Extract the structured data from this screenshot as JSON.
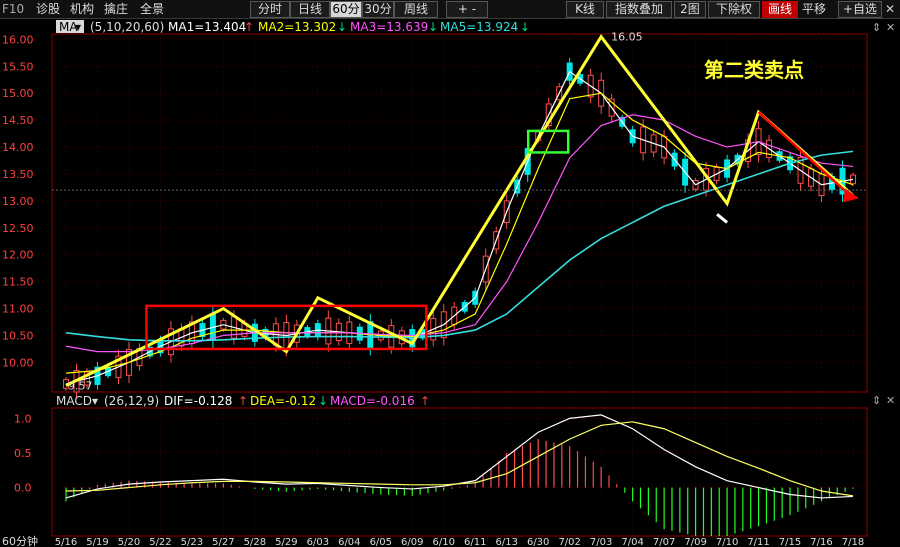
{
  "toolbar": {
    "f10": "F10",
    "left_tabs": [
      "诊股",
      "机构",
      "擒庄",
      "全景"
    ],
    "period_tabs": [
      "分时",
      "日线",
      "60分",
      "30分",
      "周线"
    ],
    "active_period": "60分",
    "plus_minus": "+ -",
    "right_buttons": [
      "K线",
      "指数叠加",
      "2图",
      "下除权",
      "画线",
      "平移",
      "+自选"
    ],
    "close_glyph": "✕"
  },
  "ma_legend": {
    "label": "MA",
    "params": "(5,10,20,60)",
    "ma1": "MA1=13.404",
    "ma2": "MA2=13.302",
    "ma3": "MA3=13.639",
    "ma5": "MA5=13.924",
    "ma1_arrow": "↑",
    "ma2_arrow": "↓",
    "ma3_arrow": "↓",
    "ma5_arrow": "↓"
  },
  "macd_legend": {
    "label": "MACD",
    "params": "(26,12,9)",
    "dif": "DIF=-0.128",
    "dea": "DEA=-0.12",
    "macd": "MACD=-0.016",
    "dif_arrow": "↑",
    "dea_arrow": "↓",
    "macd_arrow": "↑"
  },
  "annotation_title": "第二类卖点",
  "period_label": "60分钟",
  "colors": {
    "background": "#000000",
    "up": "#ff4d4d",
    "down": "#00e5e5",
    "ma1": "#ffffff",
    "ma2": "#ffff00",
    "ma3": "#ff55ff",
    "ma5": "#33dddd",
    "annotation_yellow": "#ffff33",
    "box_red": "#ff0000",
    "box_green": "#33ff33",
    "axis": "#8b0000"
  },
  "chart_data": [
    {
      "type": "candlestick",
      "title": "",
      "y_ticks": [
        "16.00",
        "15.50",
        "15.00",
        "14.50",
        "14.00",
        "13.50",
        "13.00",
        "12.50",
        "12.00",
        "11.50",
        "11.00",
        "10.50",
        "10.00"
      ],
      "ylim": [
        9.45,
        16.1
      ],
      "x_dates": [
        "5/16",
        "5/19",
        "5/20",
        "5/22",
        "5/23",
        "5/27",
        "5/28",
        "5/29",
        "6/03",
        "6/04",
        "6/05",
        "6/09",
        "6/10",
        "6/11",
        "6/13",
        "6/30",
        "7/02",
        "7/03",
        "7/04",
        "7/07",
        "7/09",
        "7/10",
        "7/11",
        "7/15",
        "7/16",
        "7/18"
      ],
      "price_labels": [
        "9.57",
        "16.05"
      ],
      "price_path": [
        {
          "x": "5/16",
          "y": 9.57
        },
        {
          "x": "5/27",
          "y": 11.0
        },
        {
          "x": "5/29",
          "y": 10.2
        },
        {
          "x": "6/03",
          "y": 11.2
        },
        {
          "x": "6/09",
          "y": 10.35
        },
        {
          "x": "7/03",
          "y": 16.05
        },
        {
          "x": "7/10",
          "y": 12.95
        },
        {
          "x": "7/11",
          "y": 14.65
        },
        {
          "x": "7/18",
          "y": 13.1
        }
      ],
      "series": [
        {
          "name": "MA1",
          "values": [
            9.6,
            9.75,
            10.0,
            10.3,
            10.55,
            10.7,
            10.55,
            10.5,
            10.6,
            10.55,
            10.5,
            10.45,
            10.7,
            11.2,
            12.8,
            14.2,
            15.4,
            15.0,
            14.2,
            14.0,
            13.3,
            13.6,
            14.1,
            13.7,
            13.3,
            13.4
          ]
        },
        {
          "name": "MA2",
          "values": [
            9.8,
            9.85,
            10.0,
            10.2,
            10.45,
            10.6,
            10.6,
            10.55,
            10.55,
            10.55,
            10.5,
            10.48,
            10.6,
            10.9,
            12.2,
            13.6,
            14.9,
            15.0,
            14.5,
            14.2,
            13.7,
            13.6,
            13.9,
            13.8,
            13.5,
            13.3
          ]
        },
        {
          "name": "MA3",
          "values": [
            10.3,
            10.2,
            10.2,
            10.25,
            10.35,
            10.5,
            10.55,
            10.55,
            10.55,
            10.55,
            10.52,
            10.5,
            10.55,
            10.7,
            11.5,
            12.6,
            13.8,
            14.4,
            14.6,
            14.5,
            14.2,
            14.0,
            14.1,
            13.9,
            13.7,
            13.64
          ]
        },
        {
          "name": "MA5",
          "values": [
            10.55,
            10.48,
            10.42,
            10.4,
            10.4,
            10.42,
            10.45,
            10.47,
            10.48,
            10.48,
            10.47,
            10.46,
            10.5,
            10.6,
            10.9,
            11.4,
            11.9,
            12.3,
            12.6,
            12.9,
            13.1,
            13.3,
            13.5,
            13.7,
            13.85,
            13.92
          ]
        }
      ]
    },
    {
      "type": "macd",
      "params": "(26,12,9)",
      "y_ticks": [
        "1.0",
        "0.5",
        "0.0"
      ],
      "ylim": [
        -0.7,
        1.15
      ],
      "series": [
        {
          "name": "DIF",
          "values": [
            -0.15,
            -0.02,
            0.05,
            0.08,
            0.1,
            0.12,
            0.08,
            0.05,
            0.06,
            0.03,
            0.0,
            -0.02,
            0.02,
            0.1,
            0.45,
            0.8,
            1.0,
            1.05,
            0.85,
            0.55,
            0.3,
            0.1,
            0.0,
            -0.1,
            -0.15,
            -0.128
          ]
        },
        {
          "name": "DEA",
          "values": [
            -0.05,
            -0.04,
            0.0,
            0.04,
            0.07,
            0.09,
            0.09,
            0.08,
            0.07,
            0.06,
            0.05,
            0.04,
            0.04,
            0.07,
            0.2,
            0.45,
            0.7,
            0.9,
            0.95,
            0.85,
            0.65,
            0.45,
            0.28,
            0.1,
            -0.05,
            -0.12
          ]
        },
        {
          "name": "MACD",
          "values": [
            -0.2,
            0.04,
            0.1,
            0.08,
            0.06,
            0.06,
            -0.02,
            -0.06,
            -0.02,
            -0.06,
            -0.1,
            -0.12,
            -0.04,
            0.06,
            0.5,
            0.7,
            0.6,
            0.3,
            -0.2,
            -0.6,
            -0.7,
            -0.7,
            -0.56,
            -0.4,
            -0.2,
            -0.016
          ]
        }
      ]
    }
  ]
}
